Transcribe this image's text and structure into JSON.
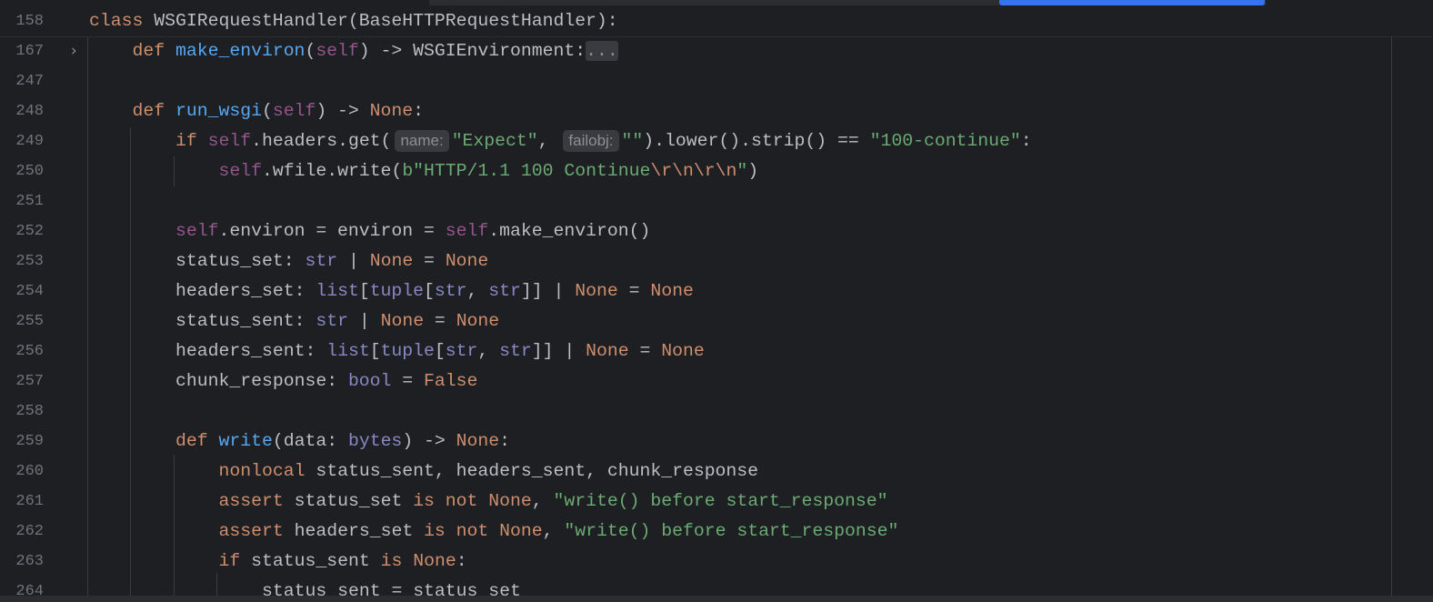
{
  "editor": {
    "lines": [
      {
        "number": "158",
        "indent": 0,
        "tokens": [
          {
            "t": "class ",
            "c": "keyword"
          },
          {
            "t": "WSGIRequestHandler(BaseHTTPRequestHandler):",
            "c": "plain"
          }
        ]
      },
      {
        "number": "167",
        "indent": 1,
        "fold": true,
        "tokens": [
          {
            "t": "def ",
            "c": "keyword"
          },
          {
            "t": "make_environ",
            "c": "func"
          },
          {
            "t": "(",
            "c": "plain"
          },
          {
            "t": "self",
            "c": "self"
          },
          {
            "t": ") -> WSGIEnvironment:",
            "c": "plain"
          },
          {
            "t": "...",
            "c": "collapsed"
          }
        ]
      },
      {
        "number": "247",
        "indent": 0,
        "tokens": []
      },
      {
        "number": "248",
        "indent": 1,
        "tokens": [
          {
            "t": "def ",
            "c": "keyword"
          },
          {
            "t": "run_wsgi",
            "c": "func"
          },
          {
            "t": "(",
            "c": "plain"
          },
          {
            "t": "self",
            "c": "self"
          },
          {
            "t": ") -> ",
            "c": "plain"
          },
          {
            "t": "None",
            "c": "keyword"
          },
          {
            "t": ":",
            "c": "plain"
          }
        ]
      },
      {
        "number": "249",
        "indent": 2,
        "tokens": [
          {
            "t": "if ",
            "c": "keyword"
          },
          {
            "t": "self",
            "c": "self"
          },
          {
            "t": ".headers.get(",
            "c": "plain"
          },
          {
            "t": "name:",
            "c": "hint"
          },
          {
            "t": "\"Expect\"",
            "c": "string"
          },
          {
            "t": ", ",
            "c": "plain"
          },
          {
            "t": "failobj:",
            "c": "hint"
          },
          {
            "t": "\"\"",
            "c": "string"
          },
          {
            "t": ").lower().strip() == ",
            "c": "plain"
          },
          {
            "t": "\"100-continue\"",
            "c": "string"
          },
          {
            "t": ":",
            "c": "plain"
          }
        ]
      },
      {
        "number": "250",
        "indent": 3,
        "tokens": [
          {
            "t": "self",
            "c": "self"
          },
          {
            "t": ".wfile.write(",
            "c": "plain"
          },
          {
            "t": "b\"HTTP/1.1 100 Continue",
            "c": "string"
          },
          {
            "t": "\\r\\n\\r\\n",
            "c": "escape"
          },
          {
            "t": "\"",
            "c": "string"
          },
          {
            "t": ")",
            "c": "plain"
          }
        ]
      },
      {
        "number": "251",
        "indent": 0,
        "tokens": []
      },
      {
        "number": "252",
        "indent": 2,
        "tokens": [
          {
            "t": "self",
            "c": "self"
          },
          {
            "t": ".environ = environ = ",
            "c": "plain"
          },
          {
            "t": "self",
            "c": "self"
          },
          {
            "t": ".make_environ()",
            "c": "plain"
          }
        ]
      },
      {
        "number": "253",
        "indent": 2,
        "tokens": [
          {
            "t": "status_set: ",
            "c": "plain"
          },
          {
            "t": "str",
            "c": "builtin"
          },
          {
            "t": " | ",
            "c": "plain"
          },
          {
            "t": "None",
            "c": "keyword"
          },
          {
            "t": " = ",
            "c": "plain"
          },
          {
            "t": "None",
            "c": "keyword"
          }
        ]
      },
      {
        "number": "254",
        "indent": 2,
        "tokens": [
          {
            "t": "headers_set: ",
            "c": "plain"
          },
          {
            "t": "list",
            "c": "builtin"
          },
          {
            "t": "[",
            "c": "plain"
          },
          {
            "t": "tuple",
            "c": "builtin"
          },
          {
            "t": "[",
            "c": "plain"
          },
          {
            "t": "str",
            "c": "builtin"
          },
          {
            "t": ", ",
            "c": "plain"
          },
          {
            "t": "str",
            "c": "builtin"
          },
          {
            "t": "]] | ",
            "c": "plain"
          },
          {
            "t": "None",
            "c": "keyword"
          },
          {
            "t": " = ",
            "c": "plain"
          },
          {
            "t": "None",
            "c": "keyword"
          }
        ]
      },
      {
        "number": "255",
        "indent": 2,
        "tokens": [
          {
            "t": "status_sent: ",
            "c": "plain"
          },
          {
            "t": "str",
            "c": "builtin"
          },
          {
            "t": " | ",
            "c": "plain"
          },
          {
            "t": "None",
            "c": "keyword"
          },
          {
            "t": " = ",
            "c": "plain"
          },
          {
            "t": "None",
            "c": "keyword"
          }
        ]
      },
      {
        "number": "256",
        "indent": 2,
        "tokens": [
          {
            "t": "headers_sent: ",
            "c": "plain"
          },
          {
            "t": "list",
            "c": "builtin"
          },
          {
            "t": "[",
            "c": "plain"
          },
          {
            "t": "tuple",
            "c": "builtin"
          },
          {
            "t": "[",
            "c": "plain"
          },
          {
            "t": "str",
            "c": "builtin"
          },
          {
            "t": ", ",
            "c": "plain"
          },
          {
            "t": "str",
            "c": "builtin"
          },
          {
            "t": "]] | ",
            "c": "plain"
          },
          {
            "t": "None",
            "c": "keyword"
          },
          {
            "t": " = ",
            "c": "plain"
          },
          {
            "t": "None",
            "c": "keyword"
          }
        ]
      },
      {
        "number": "257",
        "indent": 2,
        "tokens": [
          {
            "t": "chunk_response: ",
            "c": "plain"
          },
          {
            "t": "bool",
            "c": "builtin"
          },
          {
            "t": " = ",
            "c": "plain"
          },
          {
            "t": "False",
            "c": "keyword"
          }
        ]
      },
      {
        "number": "258",
        "indent": 0,
        "tokens": []
      },
      {
        "number": "259",
        "indent": 2,
        "tokens": [
          {
            "t": "def ",
            "c": "keyword"
          },
          {
            "t": "write",
            "c": "func"
          },
          {
            "t": "(data: ",
            "c": "plain"
          },
          {
            "t": "bytes",
            "c": "builtin"
          },
          {
            "t": ") -> ",
            "c": "plain"
          },
          {
            "t": "None",
            "c": "keyword"
          },
          {
            "t": ":",
            "c": "plain"
          }
        ]
      },
      {
        "number": "260",
        "indent": 3,
        "tokens": [
          {
            "t": "nonlocal ",
            "c": "keyword"
          },
          {
            "t": "status_sent, headers_sent, chunk_response",
            "c": "plain"
          }
        ]
      },
      {
        "number": "261",
        "indent": 3,
        "tokens": [
          {
            "t": "assert ",
            "c": "keyword"
          },
          {
            "t": "status_set ",
            "c": "plain"
          },
          {
            "t": "is not None",
            "c": "keyword"
          },
          {
            "t": ", ",
            "c": "plain"
          },
          {
            "t": "\"write() before start_response\"",
            "c": "string"
          }
        ]
      },
      {
        "number": "262",
        "indent": 3,
        "tokens": [
          {
            "t": "assert ",
            "c": "keyword"
          },
          {
            "t": "headers_set ",
            "c": "plain"
          },
          {
            "t": "is not None",
            "c": "keyword"
          },
          {
            "t": ", ",
            "c": "plain"
          },
          {
            "t": "\"write() before start_response\"",
            "c": "string"
          }
        ]
      },
      {
        "number": "263",
        "indent": 3,
        "tokens": [
          {
            "t": "if ",
            "c": "keyword"
          },
          {
            "t": "status_sent ",
            "c": "plain"
          },
          {
            "t": "is ",
            "c": "keyword"
          },
          {
            "t": "None",
            "c": "keyword"
          },
          {
            "t": ":",
            "c": "plain"
          }
        ]
      },
      {
        "number": "264",
        "indent": 4,
        "tokens": [
          {
            "t": "status_sent = status_set",
            "c": "plain"
          }
        ]
      }
    ]
  }
}
